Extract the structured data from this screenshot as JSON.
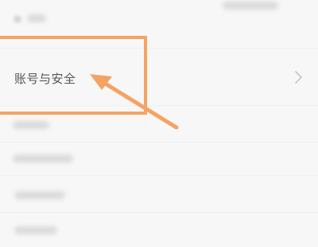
{
  "account_security": {
    "label": "账号与安全"
  },
  "icons": {
    "chevron": "chevron-right-icon",
    "arrow": "arrow-pointer-icon"
  },
  "colors": {
    "highlight": "#f4a364",
    "background": "#f7f7f7",
    "label_text": "#555555",
    "chevron": "#c8c8c8"
  }
}
